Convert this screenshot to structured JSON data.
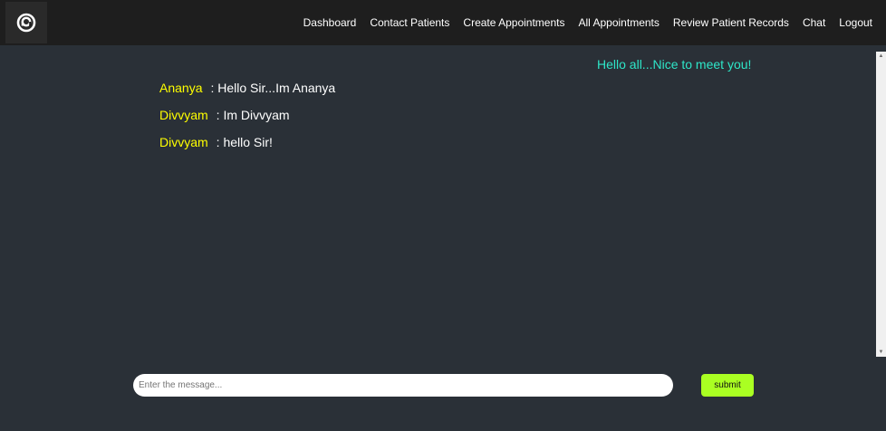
{
  "nav": {
    "links": [
      {
        "label": "Dashboard"
      },
      {
        "label": "Contact Patients"
      },
      {
        "label": "Create Appointments"
      },
      {
        "label": "All Appointments"
      },
      {
        "label": "Review Patient Records"
      },
      {
        "label": "Chat"
      },
      {
        "label": "Logout"
      }
    ]
  },
  "chat": {
    "own_message": "Hello all...Nice to meet you!",
    "messages": [
      {
        "sender": "Ananya",
        "text": ": Hello Sir...Im Ananya"
      },
      {
        "sender": "Divvyam",
        "text": ": Im Divvyam"
      },
      {
        "sender": "Divvyam",
        "text": ": hello Sir!"
      }
    ]
  },
  "composer": {
    "placeholder": "Enter the message...",
    "submit_label": "submit"
  },
  "colors": {
    "navbar_bg": "#1e1e1e",
    "page_bg": "#2a3037",
    "sender_name": "#ffff00",
    "own_message": "#2ee6c8",
    "submit_button": "#aaff22"
  },
  "icons": {
    "logo": "app-logo-icon"
  }
}
